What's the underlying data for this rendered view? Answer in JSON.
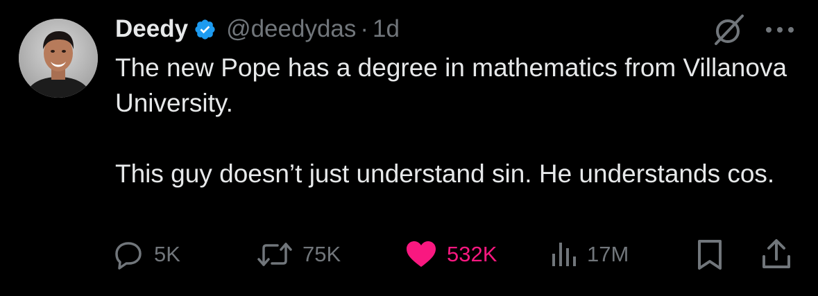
{
  "author": {
    "name": "Deedy",
    "handle": "@deedydas",
    "separator": "·",
    "time": "1d"
  },
  "tweet": {
    "paragraph_1": "The new Pope has a degree in mathematics from Villanova University.",
    "paragraph_2": "This guy doesn’t just understand sin. He understands cos."
  },
  "actions": {
    "replies": "5K",
    "reposts": "75K",
    "likes": "532K",
    "views": "17M"
  },
  "icons": {
    "verified": "verified-badge-icon",
    "grok": "grok-icon",
    "more": "more-icon",
    "reply": "reply-icon",
    "repost": "repost-icon",
    "like": "heart-icon",
    "views": "views-icon",
    "bookmark": "bookmark-icon",
    "share": "share-icon"
  },
  "colors": {
    "background": "#000000",
    "text": "#e7e9ea",
    "secondary": "#71767b",
    "verified": "#1d9bf0",
    "like": "#f91880"
  }
}
